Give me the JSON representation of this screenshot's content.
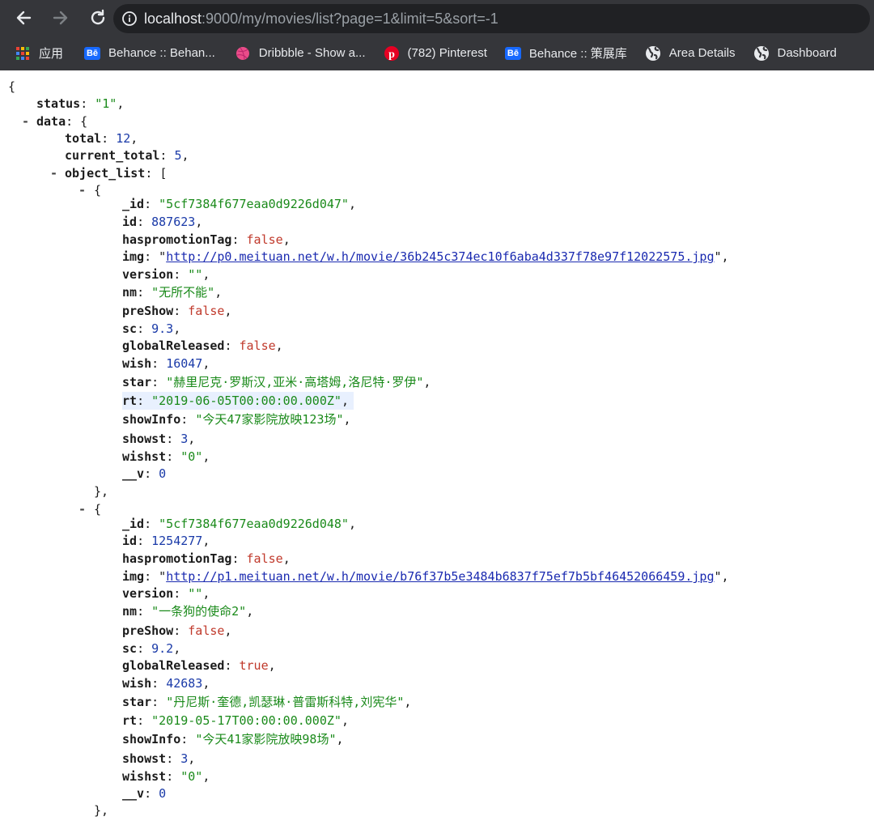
{
  "browser": {
    "url_host": "localhost",
    "url_rest": ":9000/my/movies/list?page=1&limit=5&sort=-1"
  },
  "bookmarks": [
    {
      "label": "应用",
      "icon": "apps-grid-icon"
    },
    {
      "label": "Behance :: Behan...",
      "icon": "behance-icon"
    },
    {
      "label": "Dribbble - Show a...",
      "icon": "dribbble-icon"
    },
    {
      "label": "(782) Pinterest",
      "icon": "pinterest-icon"
    },
    {
      "label": "Behance :: 策展库",
      "icon": "behance-icon"
    },
    {
      "label": "Area Details",
      "icon": "globe-icon"
    },
    {
      "label": "Dashboard",
      "icon": "globe-icon"
    }
  ],
  "json": {
    "status": "\"1\"",
    "total": "12",
    "current_total": "5",
    "items": [
      {
        "_id": "\"5cf7384f677eaa0d9226d047\"",
        "id": "887623",
        "haspromotionTag": "false",
        "img": "http://p0.meituan.net/w.h/movie/36b245c374ec10f6aba4d337f78e97f12022575.jpg",
        "version": "\"\"",
        "nm": "\"无所不能\"",
        "preShow": "false",
        "sc": "9.3",
        "globalReleased": "false",
        "wish": "16047",
        "star": "\"赫里尼克·罗斯汉,亚米·高塔姆,洛尼特·罗伊\"",
        "rt": "\"2019-06-05T00:00:00.000Z\"",
        "showInfo": "\"今天47家影院放映123场\"",
        "showst": "3",
        "wishst": "\"0\"",
        "__v": "0"
      },
      {
        "_id": "\"5cf7384f677eaa0d9226d048\"",
        "id": "1254277",
        "haspromotionTag": "false",
        "img": "http://p1.meituan.net/w.h/movie/b76f37b5e3484b6837f75ef7b5bf46452066459.jpg",
        "version": "\"\"",
        "nm": "\"一条狗的使命2\"",
        "preShow": "false",
        "sc": "9.2",
        "globalReleased": "true",
        "wish": "42683",
        "star": "\"丹尼斯·奎德,凯瑟琳·普雷斯科特,刘宪华\"",
        "rt": "\"2019-05-17T00:00:00.000Z\"",
        "showInfo": "\"今天41家影院放映98场\"",
        "showst": "3",
        "wishst": "\"0\"",
        "__v": "0"
      }
    ]
  }
}
